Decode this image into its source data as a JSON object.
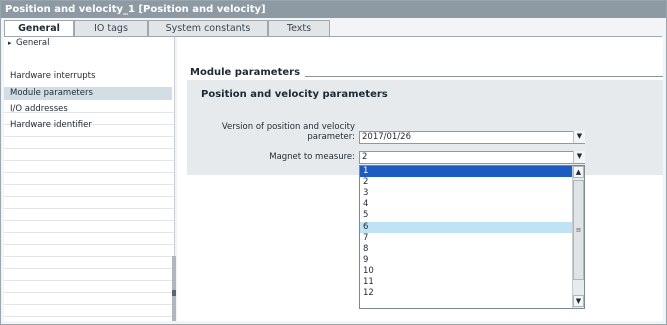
{
  "window": {
    "title": "Position and velocity_1 [Position and velocity]"
  },
  "tabs": [
    {
      "label": "General"
    },
    {
      "label": "IO tags"
    },
    {
      "label": "System constants"
    },
    {
      "label": "Texts"
    }
  ],
  "nav": {
    "items": [
      {
        "label": "General"
      },
      {
        "label": "Hardware interrupts"
      },
      {
        "label": "Module parameters"
      },
      {
        "label": "I/O addresses"
      },
      {
        "label": "Hardware identifier"
      }
    ]
  },
  "main": {
    "section_title": "Module parameters",
    "panel_title": "Position and velocity parameters",
    "version": {
      "label_line1": "Version of position and velocity",
      "label_line2": "parameter:",
      "value": "2017/01/26"
    },
    "magnet": {
      "label": "Magnet to measure:",
      "value": "2"
    }
  },
  "dropdown": {
    "options": [
      "1",
      "2",
      "3",
      "4",
      "5",
      "6",
      "7",
      "8",
      "9",
      "10",
      "11",
      "12"
    ],
    "selected": "1",
    "highlighted": "6"
  },
  "icons": {
    "caret": "▸",
    "dropdown_arrow": "▼",
    "scroll_up": "▲",
    "scroll_down": "▼",
    "grip": "≡"
  }
}
